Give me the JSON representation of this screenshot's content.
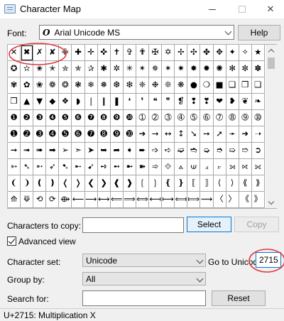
{
  "window": {
    "title": "Character Map",
    "close_glyph": "✕"
  },
  "font": {
    "label": "Font:",
    "glyph": "O",
    "value": "Arial Unicode MS",
    "help_label": "Help"
  },
  "grid": {
    "selected_index": 1,
    "rows": [
      [
        "✕",
        "✖",
        "✗",
        "✘",
        "✙",
        "✚",
        "✛",
        "✜",
        "✝",
        "✞",
        "✟",
        "✠",
        "✡",
        "✢",
        "✣",
        "✤",
        "✥",
        "✦",
        "✧",
        "★"
      ],
      [
        "✪",
        "✫",
        "✬",
        "✭",
        "✮",
        "✯",
        "✰",
        "✱",
        "✲",
        "✳",
        "✴",
        "✵",
        "✶",
        "✷",
        "✸",
        "✹",
        "✺",
        "✻",
        "✼",
        "✽"
      ],
      [
        "✾",
        "✿",
        "❀",
        "❁",
        "❂",
        "❃",
        "❄",
        "❅",
        "❆",
        "❇",
        "❈",
        "❉",
        "❊",
        "❋",
        "●",
        "❍",
        "■",
        "❏",
        "❐",
        "❑"
      ],
      [
        "❒",
        "▲",
        "▼",
        "◆",
        "❖",
        "◗",
        "❘",
        "❙",
        "❚",
        "❛",
        "❜",
        "❝",
        "❞",
        "❡",
        "❢",
        "❣",
        "❤",
        "❥",
        "❦",
        "❧"
      ],
      [
        "❶",
        "❷",
        "❸",
        "❹",
        "❺",
        "❻",
        "❼",
        "❽",
        "❾",
        "❿",
        "➀",
        "➁",
        "➂",
        "➃",
        "➄",
        "➅",
        "➆",
        "➇",
        "➈",
        "➉"
      ],
      [
        "➊",
        "➋",
        "➌",
        "➍",
        "➎",
        "➏",
        "➐",
        "➑",
        "➒",
        "➓",
        "➔",
        "→",
        "↔",
        "↕",
        "➘",
        "➙",
        "➚",
        "➛",
        "➜",
        "➝"
      ],
      [
        "➞",
        "➟",
        "➠",
        "➡",
        "➢",
        "➣",
        "➤",
        "➥",
        "➦",
        "➧",
        "➨",
        "➩",
        "➪",
        "➫",
        "➬",
        "➭",
        "➮",
        "➯",
        "➱",
        "➲"
      ],
      [
        "➳",
        "➴",
        "➵",
        "➶",
        "➷",
        "➸",
        "➹",
        "➺",
        "➻",
        "➼",
        "➽",
        "➾",
        "⟐",
        "⟑",
        "⟒",
        "⟓",
        "⟔",
        "⟕",
        "⟖",
        "⟗"
      ],
      [
        "❨",
        "❩",
        "❪",
        "❫",
        "❬",
        "❭",
        "❮",
        "❯",
        "❰",
        "❱",
        "❲",
        "❳",
        "❴",
        "❵",
        "⟦",
        "⟧",
        "⟨",
        "⟩",
        "⟪",
        "⟫"
      ],
      [
        "⟰",
        "⟱",
        "⟲",
        "⟳",
        "⟴",
        "⟵",
        "⟶",
        "⟷",
        "⟸",
        "⟹",
        "⟺",
        "⟻",
        "⟼",
        "⟽",
        "⟾",
        "⟿",
        "〈",
        "〉",
        "《",
        "》"
      ]
    ]
  },
  "copy": {
    "label": "Characters to copy:",
    "value": "",
    "select_label": "Select",
    "copy_label": "Copy"
  },
  "advanced": {
    "label": "Advanced view",
    "checked": true
  },
  "charset": {
    "label": "Character set:",
    "value": "Unicode"
  },
  "goto": {
    "label": "Go to Unicode:",
    "value": "2715"
  },
  "groupby": {
    "label": "Group by:",
    "value": "All"
  },
  "search": {
    "label": "Search for:",
    "value": "",
    "reset_label": "Reset"
  },
  "status": {
    "text": "U+2715: Multiplication X"
  },
  "colors": {
    "annotation": "#e0393e",
    "accent": "#0078d7"
  }
}
